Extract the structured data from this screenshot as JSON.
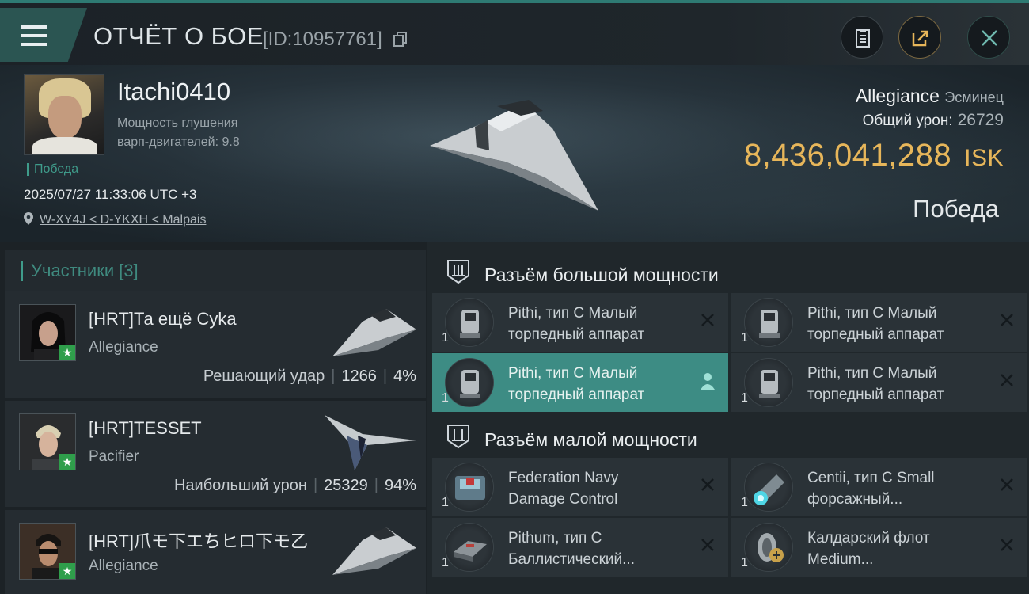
{
  "header": {
    "title": "ОТЧЁТ О БОЕ",
    "report_id": "[ID:10957761]"
  },
  "killmail": {
    "pilot_name": "Itachi0410",
    "pilot_stat_label": "Мощность глушения",
    "pilot_stat_value": "варп-двигателей: 9.8",
    "tag": "Победа",
    "datetime": "2025/07/27 11:33:06 UTC +3",
    "location": "W-XY4J < D-YKXH < Malpais",
    "ship_name": "Allegiance",
    "ship_class": "Эсминец",
    "total_damage_label": "Общий урон:",
    "total_damage_value": "26729",
    "isk_value": "8,436,041,288",
    "isk_unit": "ISK",
    "result": "Победа"
  },
  "participants": {
    "title": "Участники [3]",
    "items": [
      {
        "name": "[HRT]Та ещё Cyka",
        "ship": "Allegiance",
        "stat_label": "Решающий удар",
        "damage": "1266",
        "percent": "4%"
      },
      {
        "name": "[HRT]TESSET",
        "ship": "Pacifier",
        "stat_label": "Наибольший урон",
        "damage": "25329",
        "percent": "94%"
      },
      {
        "name": "[HRT]爪モ下エちヒロ下モ乙",
        "ship": "Allegiance",
        "stat_label": "",
        "damage": "",
        "percent": ""
      }
    ]
  },
  "fitting": {
    "high_slot_title": "Разъём большой мощности",
    "low_slot_title": "Разъём малой мощности",
    "high_modules": [
      {
        "name_line1": "Pithi, тип C Малый",
        "name_line2": "торпедный аппарат",
        "qty": "1"
      },
      {
        "name_line1": "Pithi, тип C Малый",
        "name_line2": "торпедный аппарат",
        "qty": "1"
      },
      {
        "name_line1": "Pithi, тип C Малый",
        "name_line2": "торпедный аппарат",
        "qty": "1"
      },
      {
        "name_line1": "Pithi, тип C Малый",
        "name_line2": "торпедный аппарат",
        "qty": "1"
      }
    ],
    "low_modules": [
      {
        "name_line1": "Federation Navy",
        "name_line2": "Damage Control",
        "qty": "1"
      },
      {
        "name_line1": "Centii, тип C Small",
        "name_line2": "форсажный...",
        "qty": "1"
      },
      {
        "name_line1": "Pithum, тип C",
        "name_line2": "Баллистический...",
        "qty": "1"
      },
      {
        "name_line1": "Калдарский флот",
        "name_line2": "Medium...",
        "qty": "1"
      }
    ]
  },
  "colors": {
    "accent": "#3f9c8b",
    "isk": "#e7b65a",
    "selected": "#3d8c84"
  }
}
